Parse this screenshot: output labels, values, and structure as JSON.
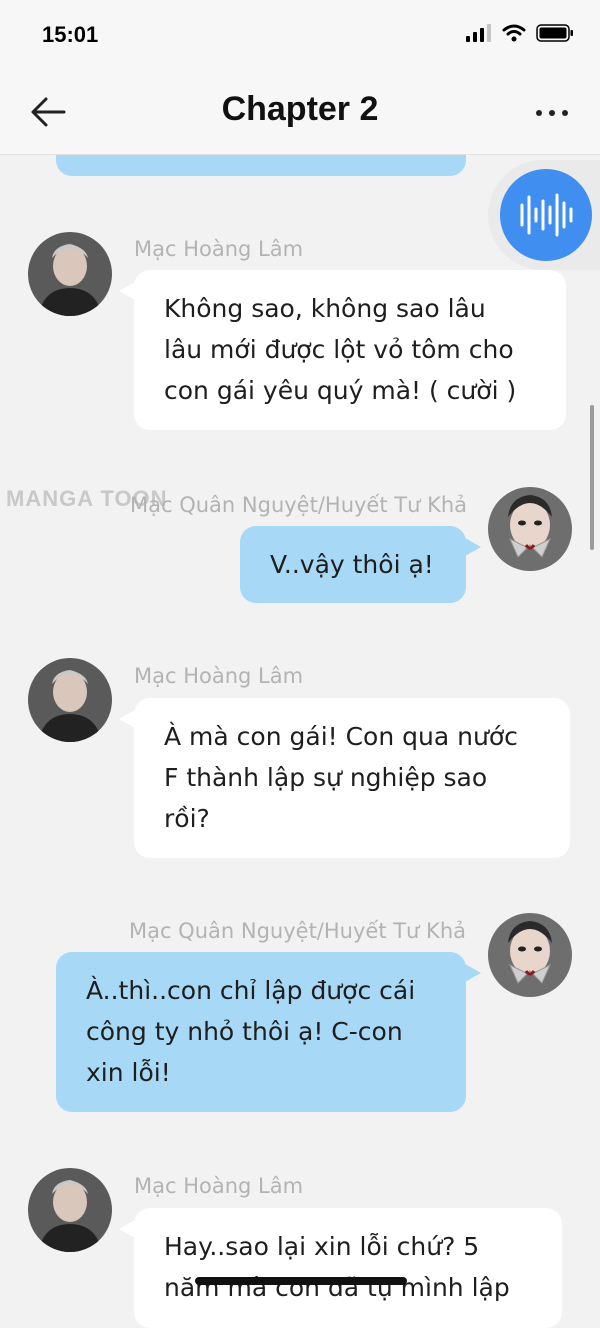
{
  "status_bar": {
    "time": "15:01"
  },
  "header": {
    "title": "Chapter 2"
  },
  "watermark": "MANGA TOON",
  "messages": [
    {
      "side": "left",
      "sender": "Mạc Hoàng Lâm",
      "text": [
        "Không sao, không sao lâu",
        "lâu mới được lột vỏ tôm cho",
        "con gái yêu quý mà! ( cười )"
      ]
    },
    {
      "side": "right",
      "sender": "Mạc Quân Nguyệt/Huyết Tư Khả",
      "text": [
        "V..vậy thôi ạ!"
      ]
    },
    {
      "side": "left",
      "sender": "Mạc Hoàng Lâm",
      "text": [
        "À mà con gái! Con qua nước",
        "F thành lập sự nghiệp sao",
        "rồi?"
      ]
    },
    {
      "side": "right",
      "sender": "Mạc Quân Nguyệt/Huyết Tư Khả",
      "text": [
        "À..thì..con chỉ lập được cái",
        "công ty nhỏ thôi ạ! C-con",
        "xin lỗi!"
      ]
    },
    {
      "side": "left",
      "sender": "Mạc Hoàng Lâm",
      "text": [
        "Hay..sao lại xin lỗi chứ? 5",
        "năm mà con đã tự mình lập"
      ]
    }
  ],
  "icons": {
    "back": "arrow-left-icon",
    "more": "more-dots-icon",
    "voice": "sound-wave-icon",
    "signal": "signal-icon",
    "wifi": "wifi-icon",
    "battery": "battery-icon"
  },
  "colors": {
    "right_bubble": "#a7d8f6",
    "left_bubble": "#ffffff",
    "fab": "#3f8ef0"
  }
}
